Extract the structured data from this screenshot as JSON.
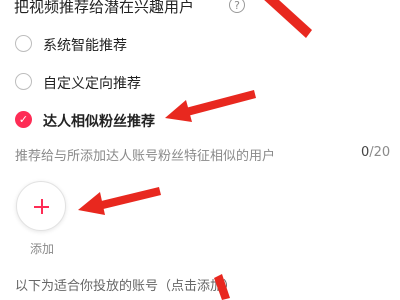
{
  "header": {
    "title": "把视频推荐给潜在兴趣用户",
    "help_icon": "?"
  },
  "options": [
    {
      "label": "系统智能推荐",
      "selected": false
    },
    {
      "label": "自定义定向推荐",
      "selected": false
    },
    {
      "label": "达人相似粉丝推荐",
      "selected": true
    }
  ],
  "hint": {
    "text": "推荐给与所添加达人账号粉丝特征相似的用户",
    "count": "0",
    "max": "/20"
  },
  "add": {
    "label": "添加",
    "icon": "plus-icon"
  },
  "footer": {
    "text": "以下为适合你投放的账号（点击添加）"
  },
  "colors": {
    "accent": "#fe2c55",
    "arrow": "#e8281f"
  }
}
